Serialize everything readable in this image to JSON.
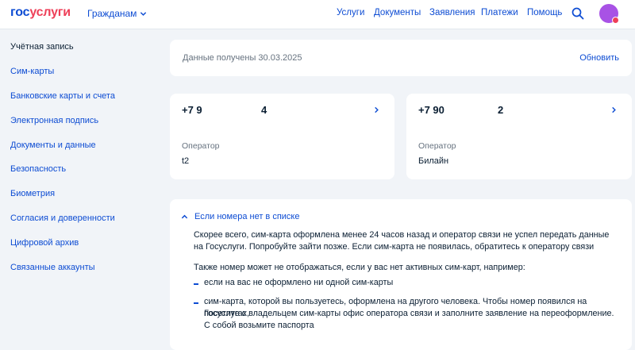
{
  "header": {
    "logo_part1": "гос",
    "logo_part2": "услуги",
    "audience": "Гражданам",
    "nav": [
      "Услуги",
      "Документы",
      "Заявления",
      "Платежи",
      "Помощь"
    ]
  },
  "sidebar": {
    "items": [
      "Учётная запись",
      "Сим-карты",
      "Банковские карты и счета",
      "Электронная подпись",
      "Документы и данные",
      "Безопасность",
      "Биометрия",
      "Согласия и доверенности",
      "Цифровой архив",
      "Связанные аккаунты"
    ]
  },
  "data_card": {
    "date_text": "Данные получены 30.03.2025",
    "refresh": "Обновить"
  },
  "sims": [
    {
      "number_part1": "+7 9",
      "number_part2": "4",
      "operator_label": "Оператор",
      "operator": "t2"
    },
    {
      "number_part1": "+7 90",
      "number_part2": "2",
      "operator_label": "Оператор",
      "operator": "Билайн"
    }
  ],
  "info": {
    "toggle": "Если номера нет в списке",
    "p1_line1": "Скорее всего, сим-карта оформлена менее 24 часов назад и оператор связи не успел передать данные",
    "p1_line2": "на Госуслуги. Попробуйте зайти позже. Если сим-карта не появилась, обратитесь к оператору связи",
    "p2": "Также номер может не отображаться, если у вас нет активных сим-карт, например:",
    "b1": "если на вас не оформлено ни одной сим-карты",
    "b2_line1": "сим-карта, которой вы пользуетесь, оформлена на другого человека. Чтобы номер появился на Госуслугах,",
    "b2_line2": "посетите с владельцем сим-карты офис оператора связи и заполните заявление на переоформление.",
    "b2_line3": "С собой возьмите паспорта"
  },
  "colors": {
    "link": "#0d4cd3",
    "logo_accent": "#ee3f58",
    "avatar": "#a852e5",
    "background": "#f1f4f8"
  }
}
